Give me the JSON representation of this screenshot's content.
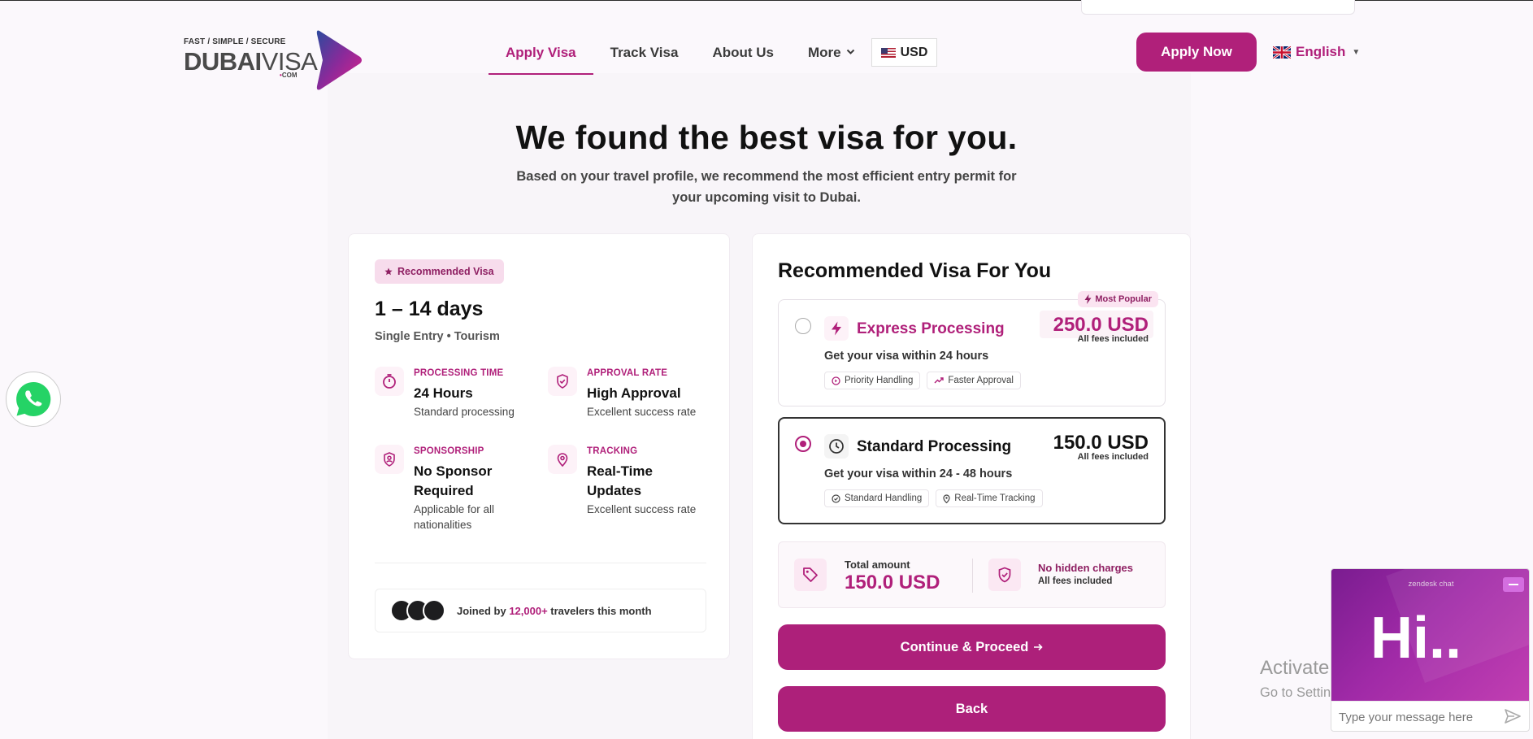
{
  "header": {
    "logo": {
      "tagline": "FAST / SIMPLE / SECURE",
      "word_bold": "DUBAI",
      "word_thin": "VISA",
      "suffix": "COM"
    },
    "nav": [
      {
        "label": "Apply Visa",
        "active": true
      },
      {
        "label": "Track Visa",
        "active": false
      },
      {
        "label": "About Us",
        "active": false
      },
      {
        "label": "More",
        "active": false
      }
    ],
    "currency": "USD",
    "apply_now": "Apply Now",
    "language": "English"
  },
  "hero": {
    "title": "We found the best visa for you.",
    "subtitle": "Based on your travel profile, we recommend the most efficient entry permit for your upcoming visit to Dubai."
  },
  "summary": {
    "badge": "Recommended Visa",
    "duration": "1 – 14 days",
    "entry": "Single Entry • Tourism",
    "features": [
      {
        "icon": "stopwatch-icon",
        "label": "PROCESSING TIME",
        "value": "24 Hours",
        "desc": "Standard processing"
      },
      {
        "icon": "shield-check-icon",
        "label": "APPROVAL RATE",
        "value": "High Approval",
        "desc": "Excellent success rate"
      },
      {
        "icon": "sponsor-id-icon",
        "label": "SPONSORSHIP",
        "value": "No Sponsor Required",
        "desc": "Applicable for all nationalities"
      },
      {
        "icon": "location-pin-icon",
        "label": "TRACKING",
        "value": "Real-Time Updates",
        "desc": "Excellent success rate"
      }
    ],
    "joined": {
      "prefix": "Joined by",
      "count": "12,000+",
      "suffix": "travelers this month"
    }
  },
  "recommendation": {
    "title": "Recommended Visa For You",
    "options": [
      {
        "name": "Express Processing",
        "price": "250.0 USD",
        "fees": "All fees included",
        "subtitle": "Get your visa within 24 hours",
        "chips": [
          "Priority Handling",
          "Faster Approval"
        ],
        "badge": "Most Popular",
        "selected": false
      },
      {
        "name": "Standard Processing",
        "price": "150.0 USD",
        "fees": "All fees included",
        "subtitle": "Get your visa within 24 - 48 hours",
        "chips": [
          "Standard Handling",
          "Real-Time Tracking"
        ],
        "selected": true
      }
    ],
    "total": {
      "label": "Total amount",
      "amount": "150.0 USD",
      "no_hidden": "No hidden charges",
      "all_fees": "All fees included"
    },
    "proceed": "Continue & Proceed",
    "back": "Back"
  },
  "chat": {
    "brand": "zendesk chat",
    "greeting": "Hi..",
    "placeholder": "Type your message here"
  },
  "watermark": {
    "line1": "Activate Windows",
    "line2": "Go to Settings to activate Windows."
  },
  "colors": {
    "accent": "#b0207a",
    "accent_soft": "#fbe4f1",
    "text": "#111111"
  }
}
